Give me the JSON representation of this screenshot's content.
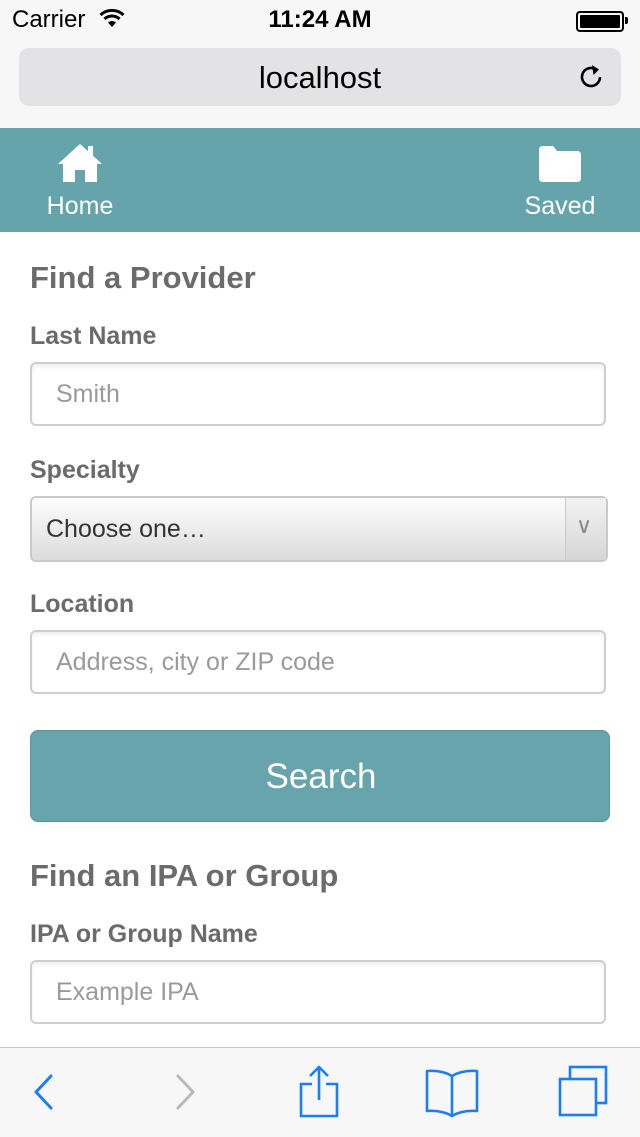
{
  "status_bar": {
    "carrier": "Carrier",
    "time": "11:24 AM",
    "wifi_icon": "wifi-icon",
    "battery_icon": "battery-icon"
  },
  "browser": {
    "url": "localhost",
    "reload_icon": "reload-icon"
  },
  "app_nav": {
    "home": {
      "label": "Home",
      "icon": "home-icon"
    },
    "saved": {
      "label": "Saved",
      "icon": "folder-icon"
    }
  },
  "provider_form": {
    "title": "Find a Provider",
    "last_name": {
      "label": "Last Name",
      "placeholder": "Smith"
    },
    "specialty": {
      "label": "Specialty",
      "selected": "Choose one…",
      "arrow": "∨"
    },
    "location": {
      "label": "Location",
      "placeholder": "Address, city or ZIP code"
    },
    "search_label": "Search"
  },
  "ipa_form": {
    "title": "Find an IPA or Group",
    "name": {
      "label": "IPA or Group Name",
      "placeholder": "Example IPA"
    }
  },
  "toolbar": {
    "icons": [
      "back-icon",
      "forward-icon",
      "share-icon",
      "bookmarks-icon",
      "tabs-icon"
    ]
  },
  "colors": {
    "accent": "#66a4ac",
    "text": "#6b6b6b",
    "ios_blue": "#1a7ef5"
  }
}
